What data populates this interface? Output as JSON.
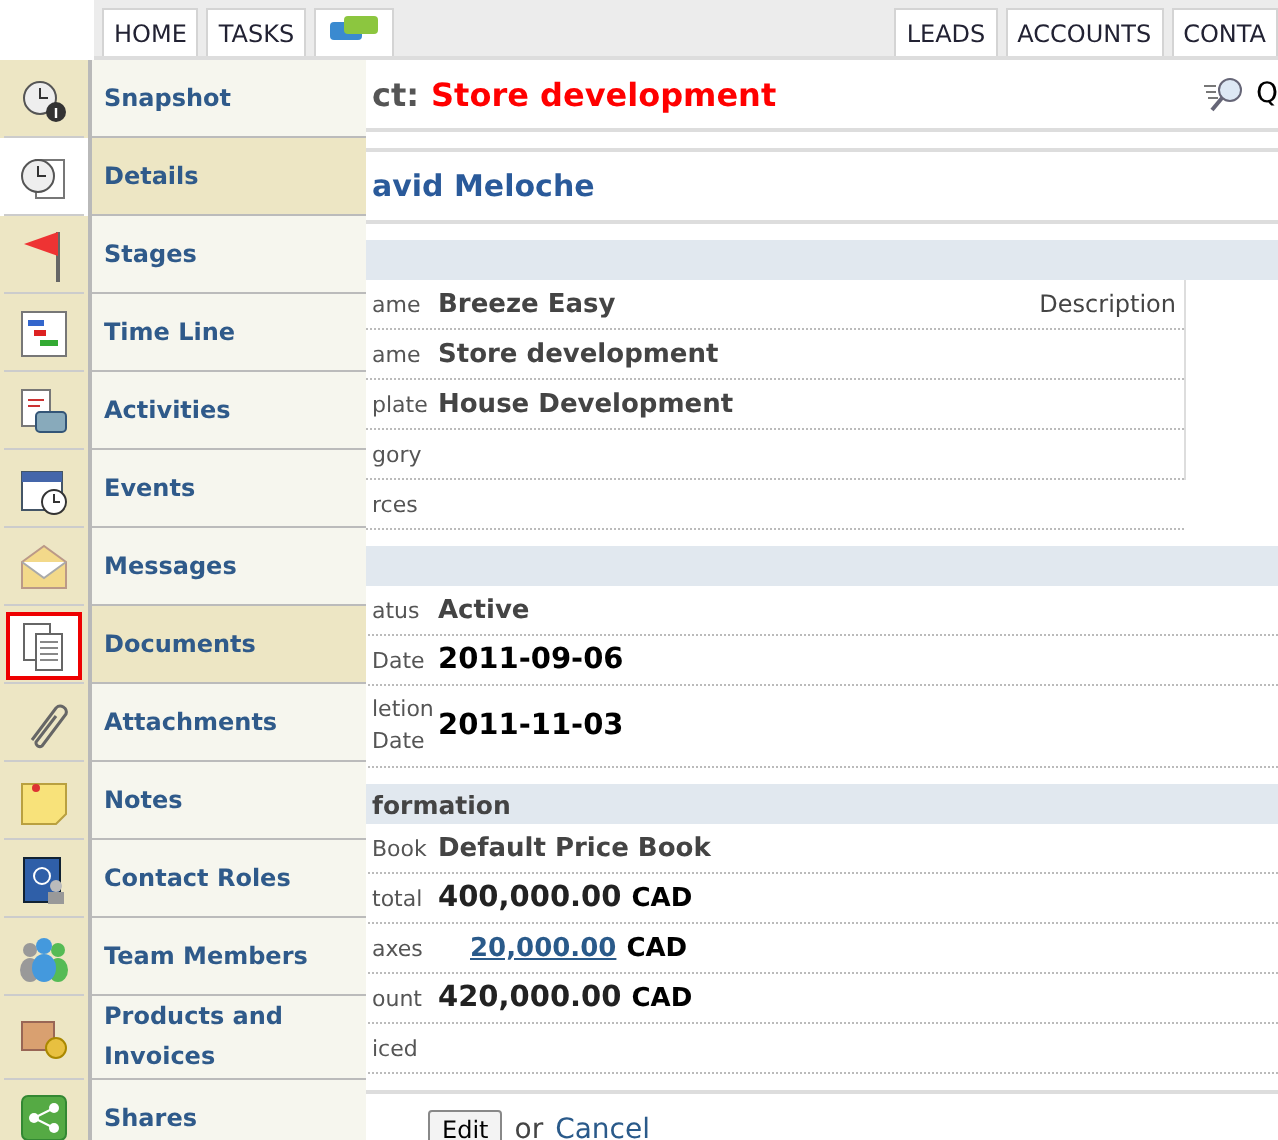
{
  "top_nav": {
    "left_tabs": [
      "HOME",
      "TASKS"
    ],
    "right_tabs": [
      "LEADS",
      "ACCOUNTS",
      "CONTA"
    ]
  },
  "title": {
    "prefix": "ct:",
    "name": "Store development",
    "quick_search": "Q"
  },
  "owner": "avid Meloche",
  "sections": [
    {
      "side_label": "Description",
      "rows": [
        {
          "label": "ame",
          "value": "Breeze Easy",
          "kind": "text"
        },
        {
          "label": "ame",
          "value": "Store development",
          "kind": "text"
        },
        {
          "label": "plate",
          "value": "House Development",
          "kind": "text"
        },
        {
          "label": "gory"
        },
        {
          "label": "rces"
        }
      ]
    },
    {
      "rows": [
        {
          "label": "atus",
          "value": "Active",
          "kind": "text"
        },
        {
          "label": "Date",
          "value": "2011-09-06",
          "kind": "strong"
        },
        {
          "label": "letion\nDate",
          "value": "2011-11-03",
          "kind": "strong"
        }
      ]
    },
    {
      "title": "formation",
      "rows": [
        {
          "label": "Book",
          "value": "Default Price Book",
          "kind": "text"
        },
        {
          "label": "total",
          "value": "400,000.00",
          "currency": "CAD",
          "kind": "amount"
        },
        {
          "label": "axes",
          "value": "20,000.00",
          "currency": "CAD",
          "kind": "link"
        },
        {
          "label": "ount",
          "value": "420,000.00",
          "currency": "CAD",
          "kind": "amount"
        },
        {
          "label": "iced"
        }
      ]
    }
  ],
  "actions": {
    "edit": "Edit",
    "or": "or",
    "cancel": "Cancel"
  },
  "menu": [
    {
      "label": "Snapshot",
      "selected": false,
      "hovered": false
    },
    {
      "label": "Details",
      "selected": true,
      "hovered": false
    },
    {
      "label": "Stages",
      "selected": false,
      "hovered": false
    },
    {
      "label": "Time Line",
      "selected": false,
      "hovered": false
    },
    {
      "label": "Activities",
      "selected": false,
      "hovered": false
    },
    {
      "label": "Events",
      "selected": false,
      "hovered": false
    },
    {
      "label": "Messages",
      "selected": false,
      "hovered": false
    },
    {
      "label": "Documents",
      "selected": false,
      "hovered": true
    },
    {
      "label": "Attachments",
      "selected": false,
      "hovered": false
    },
    {
      "label": "Notes",
      "selected": false,
      "hovered": false
    },
    {
      "label": "Contact Roles",
      "selected": false,
      "hovered": false
    },
    {
      "label": "Team Members",
      "selected": false,
      "hovered": false
    },
    {
      "label": "Products and Invoices",
      "selected": false,
      "hovered": false
    },
    {
      "label": "Shares",
      "selected": false,
      "hovered": false
    }
  ]
}
